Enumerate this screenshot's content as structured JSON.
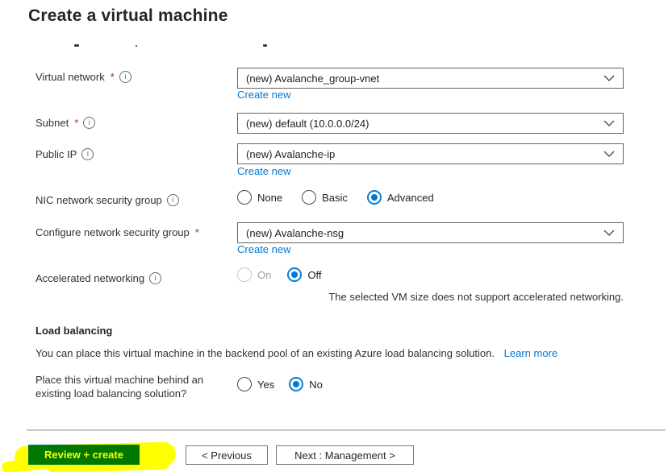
{
  "page": {
    "title": "Create a virtual machine"
  },
  "colors": {
    "accent": "#0078d4",
    "link": "#0078d4",
    "required_asterisk": "#a4262c",
    "primary_button": "#0078d4",
    "marker_highlight": "#ffff00",
    "highlight_overlap_green": "#007800",
    "border": "#646464"
  },
  "required_marker": "*",
  "form": {
    "virtual_network": {
      "label": "Virtual network",
      "value": "(new) Avalanche_group-vnet",
      "create_new": "Create new"
    },
    "subnet": {
      "label": "Subnet",
      "value": "(new) default (10.0.0.0/24)"
    },
    "public_ip": {
      "label": "Public IP",
      "value": "(new) Avalanche-ip",
      "create_new": "Create new"
    },
    "nic_nsg": {
      "label": "NIC network security group",
      "options": [
        "None",
        "Basic",
        "Advanced"
      ],
      "selected": "Advanced"
    },
    "configure_nsg": {
      "label": "Configure network security group",
      "value": "(new) Avalanche-nsg",
      "create_new": "Create new"
    },
    "accelerated_networking": {
      "label": "Accelerated networking",
      "options": [
        "On",
        "Off"
      ],
      "selected": "Off",
      "disabled_option": "On",
      "note": "The selected VM size does not support accelerated networking."
    },
    "load_balancing": {
      "heading": "Load balancing",
      "description": "You can place this virtual machine in the backend pool of an existing Azure load balancing solution.",
      "learn_more": "Learn more",
      "question": "Place this virtual machine behind an existing load balancing solution?",
      "options": [
        "Yes",
        "No"
      ],
      "selected": "No"
    }
  },
  "footer": {
    "review_create": "Review + create",
    "previous": "< Previous",
    "next": "Next : Management >"
  }
}
